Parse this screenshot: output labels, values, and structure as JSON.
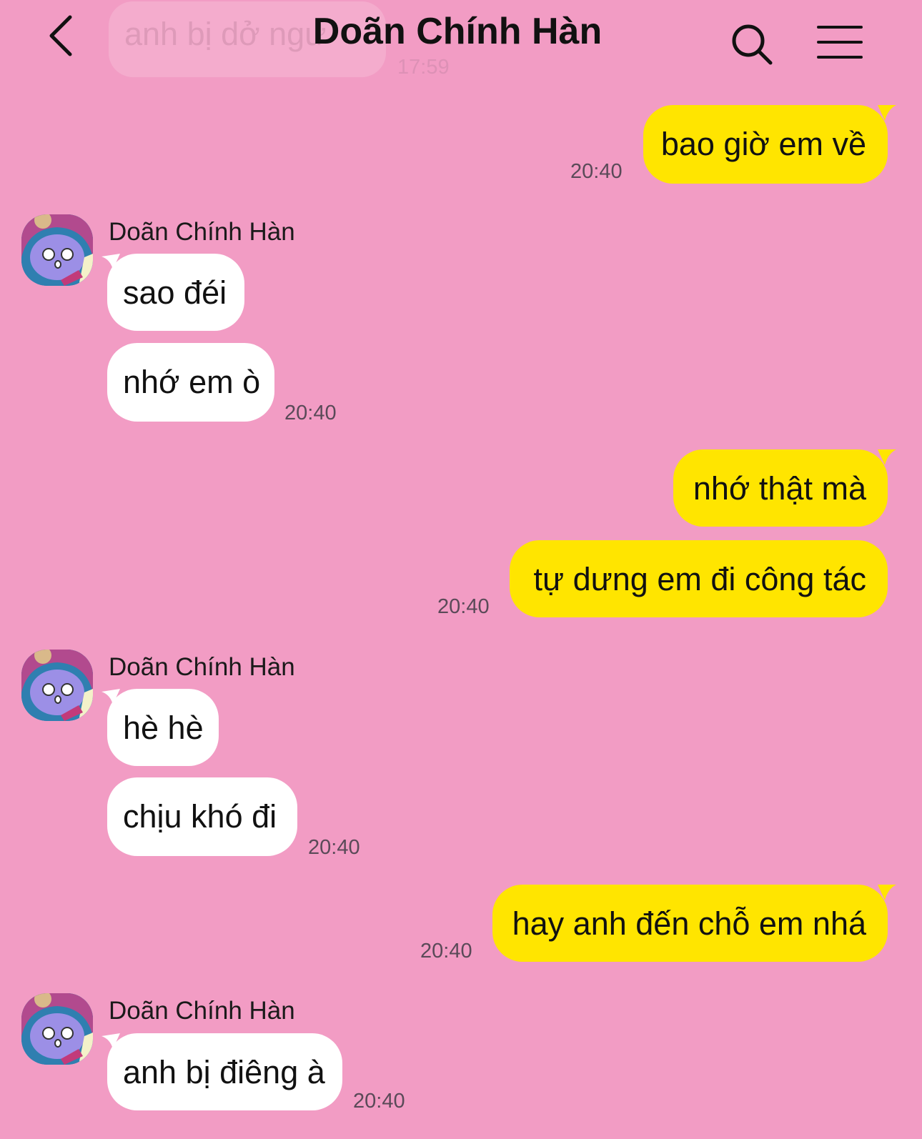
{
  "header": {
    "title": "Doãn Chính Hàn",
    "ghost_message": "anh bị dở ngư",
    "ghost_time": "17:59"
  },
  "messages": [
    {
      "side": "out",
      "text": "bao giờ em về",
      "time": "20:40"
    },
    {
      "side": "in",
      "sender": "Doãn Chính Hàn",
      "text": "sao đéi"
    },
    {
      "side": "in",
      "text": "nhớ em ò",
      "time": "20:40"
    },
    {
      "side": "out",
      "text": "nhớ thật mà"
    },
    {
      "side": "out",
      "text": "tự dưng em đi công tác",
      "time": "20:40"
    },
    {
      "side": "in",
      "sender": "Doãn Chính Hàn",
      "text": "hè hè"
    },
    {
      "side": "in",
      "text": "chịu khó đi",
      "time": "20:40"
    },
    {
      "side": "out",
      "text": "hay anh đến chỗ em nhá",
      "time": "20:40"
    },
    {
      "side": "in",
      "sender": "Doãn Chính Hàn",
      "text": "anh bị điêng à",
      "time": "20:40"
    }
  ],
  "colors": {
    "background": "#f29cc4",
    "outgoing_bubble": "#ffe500",
    "incoming_bubble": "#ffffff"
  },
  "icons": {
    "back": "chevron-left-icon",
    "search": "search-icon",
    "menu": "hamburger-menu-icon",
    "avatar": "cartoon-avatar"
  }
}
